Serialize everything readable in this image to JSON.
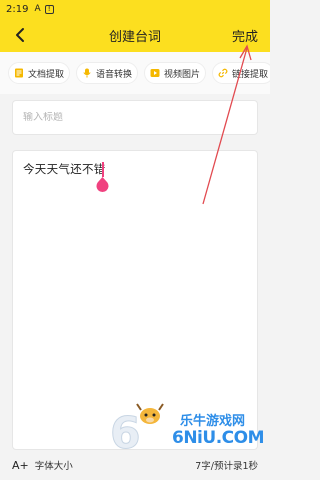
{
  "status_bar": {
    "time": "2:19",
    "icons": [
      "notification-a-icon",
      "warning-icon"
    ]
  },
  "header": {
    "title": "创建台词",
    "done_label": "完成",
    "background": "#fcdf1f"
  },
  "toolbar": {
    "items": [
      {
        "label": "文档提取",
        "icon": "document-icon",
        "color": "#f5b800"
      },
      {
        "label": "语音转换",
        "icon": "microphone-icon",
        "color": "#f5b800"
      },
      {
        "label": "视频图片",
        "icon": "video-icon",
        "color": "#f5b800"
      },
      {
        "label": "链接提取",
        "icon": "link-icon",
        "color": "#f5b800"
      }
    ]
  },
  "title_field": {
    "placeholder": "输入标题",
    "value": ""
  },
  "editor": {
    "content": "今天天气还不错",
    "cursor_color": "#f0417f"
  },
  "footer": {
    "font_size_icon": "A+",
    "font_size_label": "字体大小",
    "count_text": "7字/预计录1秒"
  },
  "watermark": {
    "line1": "乐牛游戏网",
    "line2": "6NiU.COM"
  },
  "annotation": {
    "arrow_color": "#e24a50"
  }
}
